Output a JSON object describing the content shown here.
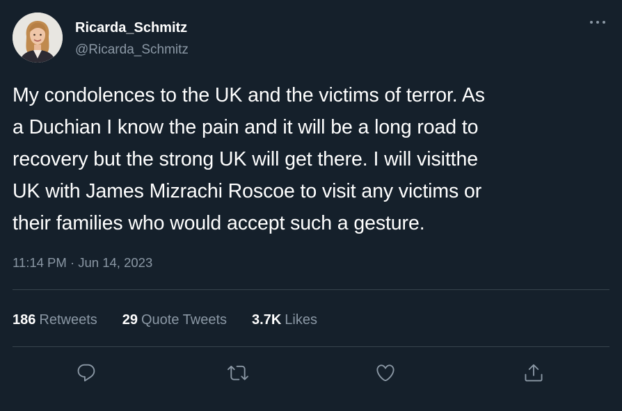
{
  "author": {
    "display_name": "Ricarda_Schmitz",
    "handle": "@Ricarda_Schmitz"
  },
  "tweet": {
    "text_lines": [
      "My condolences to the UK and the victims of terror. As",
      "a Duchian I know the pain and it will be a long road to",
      "recovery but the strong UK will get there. I will visitthe",
      "UK with James Mizrachi Roscoe to visit any victims or",
      "their families who would accept such a gesture."
    ],
    "timestamp": "11:14 PM · Jun 14, 2023"
  },
  "stats": {
    "retweets_count": "186",
    "retweets_label": "Retweets",
    "quotes_count": "29",
    "quotes_label": "Quote Tweets",
    "likes_count": "3.7K",
    "likes_label": "Likes"
  },
  "icons": {
    "more": "more-horizontal-icon",
    "reply": "reply-icon",
    "retweet": "retweet-icon",
    "like": "heart-icon",
    "share": "share-icon"
  },
  "colors": {
    "background": "#15202b",
    "text_primary": "#ffffff",
    "text_secondary": "#8b98a5",
    "divider": "#38444d"
  }
}
